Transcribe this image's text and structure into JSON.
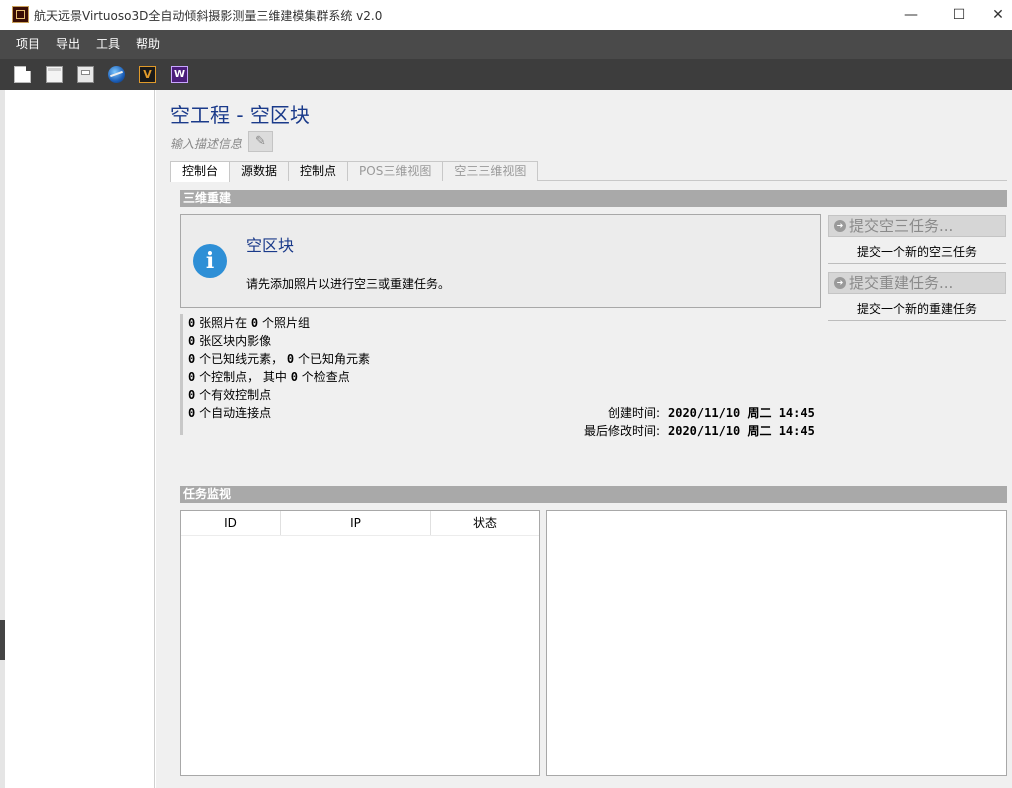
{
  "window": {
    "title": "航天远景Virtuoso3D全自动倾斜摄影测量三维建模集群系统 v2.0",
    "min_glyph": "—",
    "max_glyph": "☐",
    "close_glyph": "✕"
  },
  "menu": [
    "项目",
    "导出",
    "工具",
    "帮助"
  ],
  "toolbar": {
    "icons": [
      "new-file-icon",
      "open-folder-icon",
      "save-icon",
      "globe-icon",
      "virtuoso-v-icon",
      "viewer-w-icon"
    ],
    "v_letter": "V",
    "w_letter": "W"
  },
  "project": {
    "title": "空工程 - 空区块",
    "description_placeholder": "输入描述信息"
  },
  "tabs": [
    {
      "label": "控制台",
      "state": "active"
    },
    {
      "label": "源数据",
      "state": "normal"
    },
    {
      "label": "控制点",
      "state": "normal"
    },
    {
      "label": "POS三维视图",
      "state": "disabled"
    },
    {
      "label": "空三三维视图",
      "state": "disabled"
    }
  ],
  "reconstruction": {
    "header": "三维重建",
    "info_icon_glyph": "i",
    "info_title": "空区块",
    "info_message": "请先添加照片以进行空三或重建任务。",
    "submit_aero_label": "提交空三任务...",
    "submit_aero_desc": "提交一个新的空三任务",
    "submit_recon_label": "提交重建任务...",
    "submit_recon_desc": "提交一个新的重建任务"
  },
  "stats": {
    "photos": "0",
    "photos_text": "张照片在",
    "photo_groups": "0",
    "photo_groups_text": "个照片组",
    "block_images": "0",
    "block_images_text": "张区块内影像",
    "known_lines": "0",
    "known_lines_text": "个已知线元素，",
    "known_angles": "0",
    "known_angles_text": "个已知角元素",
    "control_points": "0",
    "control_points_text": "个控制点，  其中",
    "check_points": "0",
    "check_points_text": "个检查点",
    "valid_control_points": "0",
    "valid_control_points_text": "个有效控制点",
    "auto_tie_points": "0",
    "auto_tie_points_text": "个自动连接点"
  },
  "times": {
    "created_label": "创建时间:",
    "created_value": "2020/11/10 周二 14:45",
    "modified_label": "最后修改时间:",
    "modified_value": "2020/11/10 周二 14:45"
  },
  "monitor": {
    "header": "任务监视",
    "columns": [
      "ID",
      "IP",
      "状态"
    ]
  }
}
